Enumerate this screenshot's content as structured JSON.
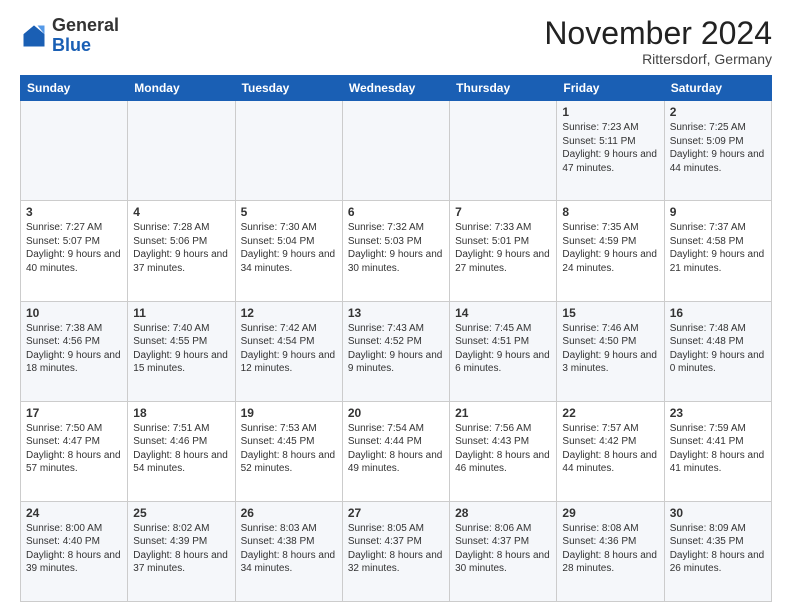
{
  "header": {
    "logo": {
      "general": "General",
      "blue": "Blue"
    },
    "title": "November 2024",
    "location": "Rittersdorf, Germany"
  },
  "weekdays": [
    "Sunday",
    "Monday",
    "Tuesday",
    "Wednesday",
    "Thursday",
    "Friday",
    "Saturday"
  ],
  "weeks": [
    [
      {
        "day": "",
        "detail": ""
      },
      {
        "day": "",
        "detail": ""
      },
      {
        "day": "",
        "detail": ""
      },
      {
        "day": "",
        "detail": ""
      },
      {
        "day": "",
        "detail": ""
      },
      {
        "day": "1",
        "detail": "Sunrise: 7:23 AM\nSunset: 5:11 PM\nDaylight: 9 hours and 47 minutes."
      },
      {
        "day": "2",
        "detail": "Sunrise: 7:25 AM\nSunset: 5:09 PM\nDaylight: 9 hours and 44 minutes."
      }
    ],
    [
      {
        "day": "3",
        "detail": "Sunrise: 7:27 AM\nSunset: 5:07 PM\nDaylight: 9 hours and 40 minutes."
      },
      {
        "day": "4",
        "detail": "Sunrise: 7:28 AM\nSunset: 5:06 PM\nDaylight: 9 hours and 37 minutes."
      },
      {
        "day": "5",
        "detail": "Sunrise: 7:30 AM\nSunset: 5:04 PM\nDaylight: 9 hours and 34 minutes."
      },
      {
        "day": "6",
        "detail": "Sunrise: 7:32 AM\nSunset: 5:03 PM\nDaylight: 9 hours and 30 minutes."
      },
      {
        "day": "7",
        "detail": "Sunrise: 7:33 AM\nSunset: 5:01 PM\nDaylight: 9 hours and 27 minutes."
      },
      {
        "day": "8",
        "detail": "Sunrise: 7:35 AM\nSunset: 4:59 PM\nDaylight: 9 hours and 24 minutes."
      },
      {
        "day": "9",
        "detail": "Sunrise: 7:37 AM\nSunset: 4:58 PM\nDaylight: 9 hours and 21 minutes."
      }
    ],
    [
      {
        "day": "10",
        "detail": "Sunrise: 7:38 AM\nSunset: 4:56 PM\nDaylight: 9 hours and 18 minutes."
      },
      {
        "day": "11",
        "detail": "Sunrise: 7:40 AM\nSunset: 4:55 PM\nDaylight: 9 hours and 15 minutes."
      },
      {
        "day": "12",
        "detail": "Sunrise: 7:42 AM\nSunset: 4:54 PM\nDaylight: 9 hours and 12 minutes."
      },
      {
        "day": "13",
        "detail": "Sunrise: 7:43 AM\nSunset: 4:52 PM\nDaylight: 9 hours and 9 minutes."
      },
      {
        "day": "14",
        "detail": "Sunrise: 7:45 AM\nSunset: 4:51 PM\nDaylight: 9 hours and 6 minutes."
      },
      {
        "day": "15",
        "detail": "Sunrise: 7:46 AM\nSunset: 4:50 PM\nDaylight: 9 hours and 3 minutes."
      },
      {
        "day": "16",
        "detail": "Sunrise: 7:48 AM\nSunset: 4:48 PM\nDaylight: 9 hours and 0 minutes."
      }
    ],
    [
      {
        "day": "17",
        "detail": "Sunrise: 7:50 AM\nSunset: 4:47 PM\nDaylight: 8 hours and 57 minutes."
      },
      {
        "day": "18",
        "detail": "Sunrise: 7:51 AM\nSunset: 4:46 PM\nDaylight: 8 hours and 54 minutes."
      },
      {
        "day": "19",
        "detail": "Sunrise: 7:53 AM\nSunset: 4:45 PM\nDaylight: 8 hours and 52 minutes."
      },
      {
        "day": "20",
        "detail": "Sunrise: 7:54 AM\nSunset: 4:44 PM\nDaylight: 8 hours and 49 minutes."
      },
      {
        "day": "21",
        "detail": "Sunrise: 7:56 AM\nSunset: 4:43 PM\nDaylight: 8 hours and 46 minutes."
      },
      {
        "day": "22",
        "detail": "Sunrise: 7:57 AM\nSunset: 4:42 PM\nDaylight: 8 hours and 44 minutes."
      },
      {
        "day": "23",
        "detail": "Sunrise: 7:59 AM\nSunset: 4:41 PM\nDaylight: 8 hours and 41 minutes."
      }
    ],
    [
      {
        "day": "24",
        "detail": "Sunrise: 8:00 AM\nSunset: 4:40 PM\nDaylight: 8 hours and 39 minutes."
      },
      {
        "day": "25",
        "detail": "Sunrise: 8:02 AM\nSunset: 4:39 PM\nDaylight: 8 hours and 37 minutes."
      },
      {
        "day": "26",
        "detail": "Sunrise: 8:03 AM\nSunset: 4:38 PM\nDaylight: 8 hours and 34 minutes."
      },
      {
        "day": "27",
        "detail": "Sunrise: 8:05 AM\nSunset: 4:37 PM\nDaylight: 8 hours and 32 minutes."
      },
      {
        "day": "28",
        "detail": "Sunrise: 8:06 AM\nSunset: 4:37 PM\nDaylight: 8 hours and 30 minutes."
      },
      {
        "day": "29",
        "detail": "Sunrise: 8:08 AM\nSunset: 4:36 PM\nDaylight: 8 hours and 28 minutes."
      },
      {
        "day": "30",
        "detail": "Sunrise: 8:09 AM\nSunset: 4:35 PM\nDaylight: 8 hours and 26 minutes."
      }
    ]
  ]
}
